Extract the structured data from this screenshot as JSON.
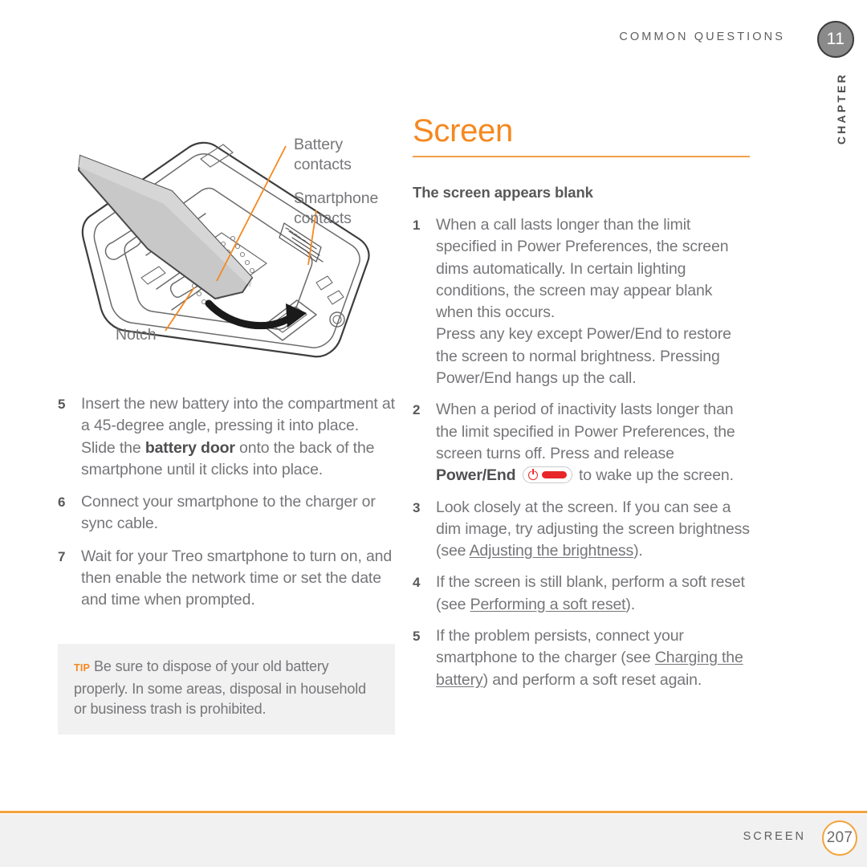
{
  "header": {
    "kicker": "COMMON QUESTIONS",
    "chapter_number": "11",
    "chapter_word": "CHAPTER"
  },
  "illustration": {
    "alt": "Treo smartphone back with battery inserted at an angle",
    "callouts": {
      "battery_contacts": "Battery contacts",
      "smartphone_contacts": "Smartphone contacts",
      "notch": "Notch"
    }
  },
  "left_column": {
    "steps": [
      {
        "number": "5",
        "parts": [
          {
            "text": "Insert the new battery into the compartment at a 45-degree angle, pressing it into place. Slide the ",
            "style": "normal"
          },
          {
            "text": "battery door",
            "style": "bold"
          },
          {
            "text": " onto the back of the smartphone until it clicks into place.",
            "style": "normal"
          }
        ]
      },
      {
        "number": "6",
        "parts": [
          {
            "text": "Connect your smartphone to the charger or sync cable.",
            "style": "normal"
          }
        ]
      },
      {
        "number": "7",
        "parts": [
          {
            "text": "Wait for your Treo smartphone to turn on, and then enable the network time or set the date and time when prompted.",
            "style": "normal"
          }
        ]
      }
    ],
    "tip": {
      "label": "TIP",
      "text": "Be sure to dispose of your old battery properly. In some areas, disposal in household or business trash is prohibited."
    }
  },
  "right_column": {
    "title": "Screen",
    "subhead": "The screen appears blank",
    "steps": [
      {
        "number": "1",
        "parts": [
          {
            "text": "When a call lasts longer than the limit specified in Power Preferences, the screen dims automatically. In certain lighting conditions, the screen may appear blank when this occurs.",
            "style": "normal"
          },
          {
            "text": "\n",
            "style": "break"
          },
          {
            "text": "Press any key except Power/End to restore the screen to normal brightness. Pressing Power/End hangs up the call.",
            "style": "normal"
          }
        ]
      },
      {
        "number": "2",
        "parts": [
          {
            "text": "When a period of inactivity lasts longer than the limit specified in Power Preferences, the screen turns off. Press and release ",
            "style": "normal"
          },
          {
            "text": "Power/End",
            "style": "bold"
          },
          {
            "text": " ",
            "style": "normal"
          },
          {
            "text": "power-end-key-icon",
            "style": "icon"
          },
          {
            "text": " to wake up the screen.",
            "style": "normal"
          }
        ]
      },
      {
        "number": "3",
        "parts": [
          {
            "text": "Look closely at the screen. If you can see a dim image, try adjusting the screen brightness (see ",
            "style": "normal"
          },
          {
            "text": "Adjusting the brightness",
            "style": "xref"
          },
          {
            "text": ").",
            "style": "normal"
          }
        ]
      },
      {
        "number": "4",
        "parts": [
          {
            "text": "If the screen is still blank, perform a soft reset (see ",
            "style": "normal"
          },
          {
            "text": "Performing a soft reset",
            "style": "xref"
          },
          {
            "text": ").",
            "style": "normal"
          }
        ]
      },
      {
        "number": "5",
        "parts": [
          {
            "text": "If the problem persists, connect your smartphone to the charger (see ",
            "style": "normal"
          },
          {
            "text": "Charging the battery",
            "style": "xref"
          },
          {
            "text": ") and perform a soft reset again.",
            "style": "normal"
          }
        ]
      }
    ]
  },
  "footer": {
    "label": "SCREEN",
    "page_number": "207"
  },
  "colors": {
    "accent_orange": "#F5881F",
    "rule_orange": "#F2A33C",
    "body_gray": "#76767a",
    "heading_gray": "#58585a",
    "key_red": "#E8262A",
    "tip_background": "#f1f1f1"
  }
}
